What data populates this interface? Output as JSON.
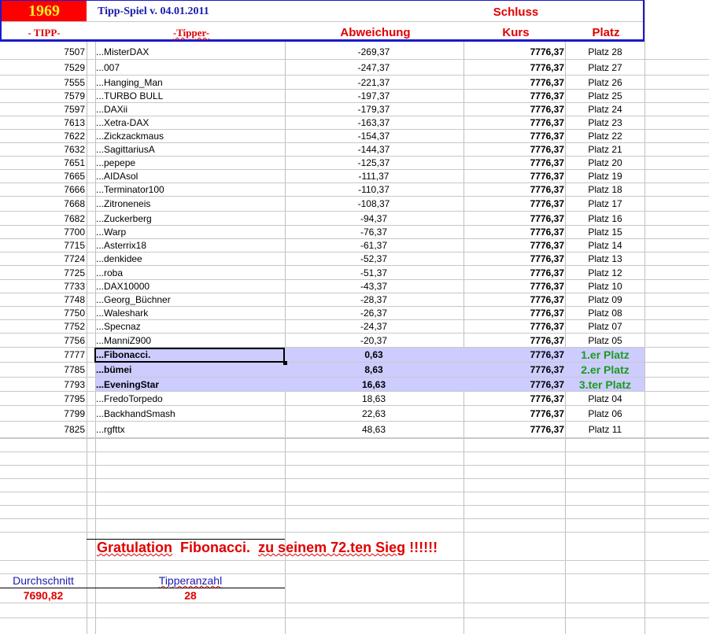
{
  "header": {
    "year": "1969",
    "title": "Tipp-Spiel v. 04.01.2011",
    "col_tipp": "- TIPP-",
    "col_tipper": "-Tipper-",
    "col_abw": "Abweichung",
    "schluss": "Schluss",
    "col_kurs": "Kurs",
    "col_platz": "Platz"
  },
  "rows": [
    {
      "tipp": "7507",
      "name": "...MisterDAX",
      "abw": "-269,37",
      "kurs": "7776,37",
      "platz": "Platz 28"
    },
    {
      "tipp": "7529",
      "name": "...007",
      "abw": "-247,37",
      "kurs": "7776,37",
      "platz": "Platz 27"
    },
    {
      "tipp": "7555",
      "name": "...Hanging_Man",
      "abw": "-221,37",
      "kurs": "7776,37",
      "platz": "Platz 26"
    },
    {
      "tipp": "7579",
      "name": "...TURBO BULL",
      "abw": "-197,37",
      "kurs": "7776,37",
      "platz": "Platz 25"
    },
    {
      "tipp": "7597",
      "name": "...DAXii",
      "abw": "-179,37",
      "kurs": "7776,37",
      "platz": "Platz 24"
    },
    {
      "tipp": "7613",
      "name": "...Xetra-DAX",
      "abw": "-163,37",
      "kurs": "7776,37",
      "platz": "Platz 23"
    },
    {
      "tipp": "7622",
      "name": "...Zickzackmaus",
      "abw": "-154,37",
      "kurs": "7776,37",
      "platz": "Platz 22"
    },
    {
      "tipp": "7632",
      "name": "...SagittariusA",
      "abw": "-144,37",
      "kurs": "7776,37",
      "platz": "Platz 21"
    },
    {
      "tipp": "7651",
      "name": "...pepepe",
      "abw": "-125,37",
      "kurs": "7776,37",
      "platz": "Platz 20"
    },
    {
      "tipp": "7665",
      "name": "...AIDAsol",
      "abw": "-111,37",
      "kurs": "7776,37",
      "platz": "Platz 19"
    },
    {
      "tipp": "7666",
      "name": "...Terminator100",
      "abw": "-110,37",
      "kurs": "7776,37",
      "platz": "Platz 18"
    },
    {
      "tipp": "7668",
      "name": "...Zitroneneis",
      "abw": "-108,37",
      "kurs": "7776,37",
      "platz": "Platz 17"
    },
    {
      "tipp": "7682",
      "name": "...Zuckerberg",
      "abw": "-94,37",
      "kurs": "7776,37",
      "platz": "Platz 16"
    },
    {
      "tipp": "7700",
      "name": "...Warp",
      "abw": "-76,37",
      "kurs": "7776,37",
      "platz": "Platz 15"
    },
    {
      "tipp": "7715",
      "name": "...Asterrix18",
      "abw": "-61,37",
      "kurs": "7776,37",
      "platz": "Platz 14"
    },
    {
      "tipp": "7724",
      "name": "...denkidee",
      "abw": "-52,37",
      "kurs": "7776,37",
      "platz": "Platz 13"
    },
    {
      "tipp": "7725",
      "name": "...roba",
      "abw": "-51,37",
      "kurs": "7776,37",
      "platz": "Platz 12"
    },
    {
      "tipp": "7733",
      "name": "...DAX10000",
      "abw": "-43,37",
      "kurs": "7776,37",
      "platz": "Platz 10"
    },
    {
      "tipp": "7748",
      "name": "...Georg_Büchner",
      "abw": "-28,37",
      "kurs": "7776,37",
      "platz": "Platz 09"
    },
    {
      "tipp": "7750",
      "name": "...Waleshark",
      "abw": "-26,37",
      "kurs": "7776,37",
      "platz": "Platz 08"
    },
    {
      "tipp": "7752",
      "name": "...Specnaz",
      "abw": "-24,37",
      "kurs": "7776,37",
      "platz": "Platz 07"
    },
    {
      "tipp": "7756",
      "name": "...ManniZ900",
      "abw": "-20,37",
      "kurs": "7776,37",
      "platz": "Platz 05"
    },
    {
      "tipp": "7777",
      "name": "...Fibonacci.",
      "abw": "0,63",
      "kurs": "7776,37",
      "platz": "1.er Platz",
      "winner": true
    },
    {
      "tipp": "7785",
      "name": "...bümei",
      "abw": "8,63",
      "kurs": "7776,37",
      "platz": "2.er Platz",
      "winner": true
    },
    {
      "tipp": "7793",
      "name": "...EveningStar",
      "abw": "16,63",
      "kurs": "7776,37",
      "platz": "3.ter Platz",
      "winner": true
    },
    {
      "tipp": "7795",
      "name": "...FredoTorpedo",
      "abw": "18,63",
      "kurs": "7776,37",
      "platz": "Platz 04"
    },
    {
      "tipp": "7799",
      "name": "...BackhandSmash",
      "abw": "22,63",
      "kurs": "7776,37",
      "platz": "Platz 06"
    },
    {
      "tipp": "7825",
      "name": "...rgfttx",
      "abw": "48,63",
      "kurs": "7776,37",
      "platz": "Platz 11"
    }
  ],
  "footer": {
    "gratulation_1": "Gratulation",
    "gratulation_name": "Fibonacci.",
    "gratulation_2": "zu seinem 72.ten Sieg",
    "gratulation_excl": "!!!!!!",
    "durchschnitt_label": "Durchschnitt",
    "durchschnitt_value": "7690,82",
    "tipperanzahl_label": "Tipperanzahl",
    "tipperanzahl_value": "28"
  },
  "colors": {
    "highlight": "#ccccff",
    "winner": "#1a9c1a",
    "red": "#e00000",
    "blue": "#1a1ab0"
  }
}
